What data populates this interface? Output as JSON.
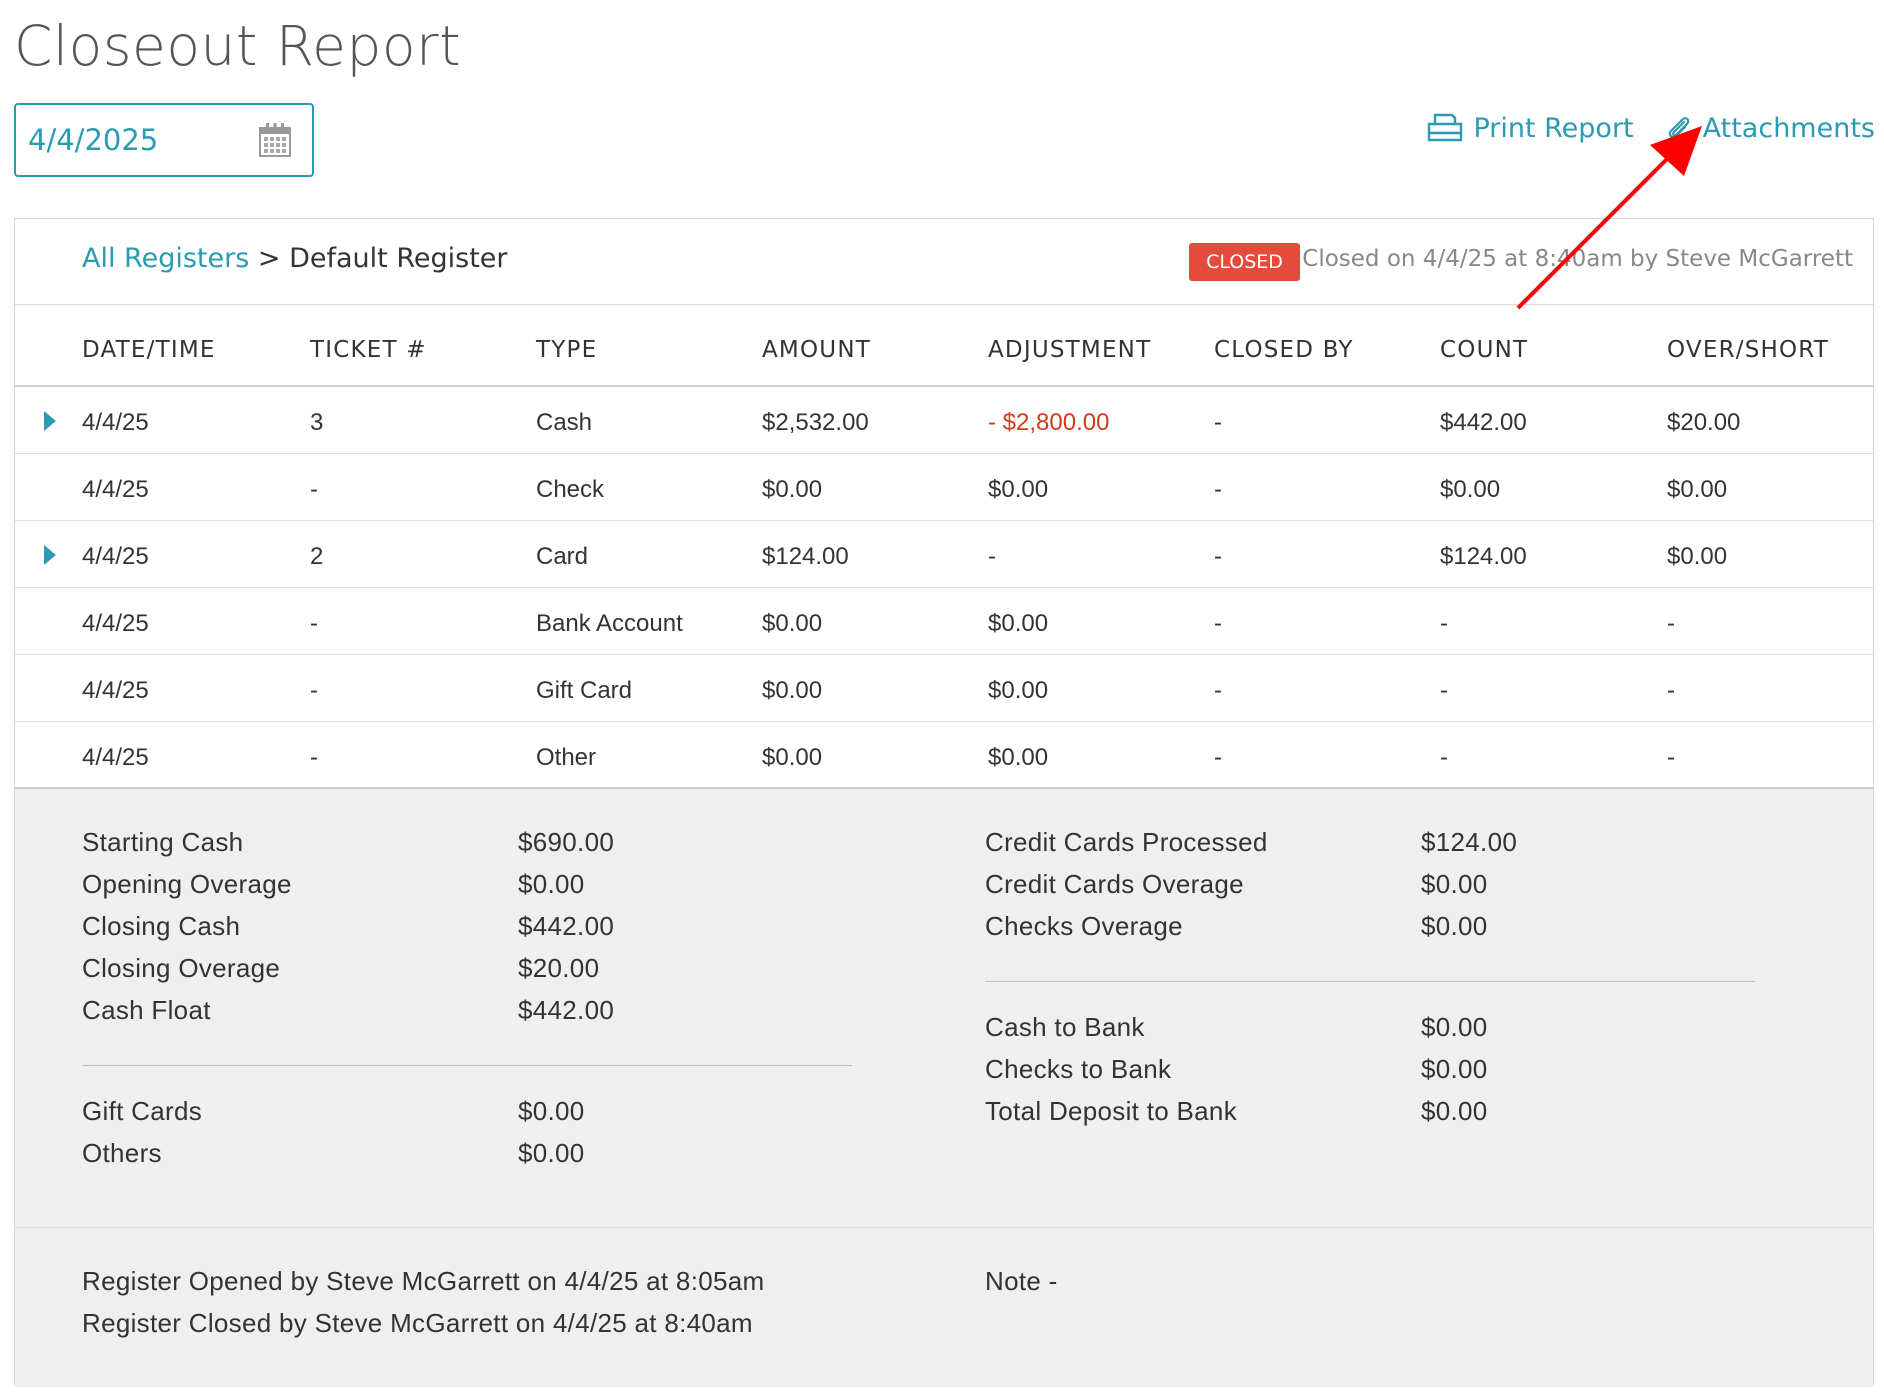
{
  "page": {
    "title": "Closeout Report"
  },
  "date_picker": {
    "value": "4/4/2025"
  },
  "actions": {
    "print_label": "Print Report",
    "attachments_label": "Attachments"
  },
  "register": {
    "breadcrumb_root": "All Registers",
    "separator": ">",
    "current": "Default Register",
    "status_badge": "CLOSED",
    "closed_info": "Closed on 4/4/25 at 8:40am by Steve McGarrett"
  },
  "table": {
    "headers": [
      "DATE/TIME",
      "TICKET #",
      "TYPE",
      "AMOUNT",
      "ADJUSTMENT",
      "CLOSED BY",
      "COUNT",
      "OVER/SHORT"
    ],
    "rows": [
      {
        "expandable": true,
        "cells": [
          "4/4/25",
          "3",
          "Cash",
          "$2,532.00",
          "- $2,800.00",
          "-",
          "$442.00",
          "$20.00"
        ],
        "negative_adjustment": true
      },
      {
        "expandable": false,
        "cells": [
          "4/4/25",
          "-",
          "Check",
          "$0.00",
          "$0.00",
          "-",
          "$0.00",
          "$0.00"
        ],
        "negative_adjustment": false
      },
      {
        "expandable": true,
        "cells": [
          "4/4/25",
          "2",
          "Card",
          "$124.00",
          "-",
          "-",
          "$124.00",
          "$0.00"
        ],
        "negative_adjustment": false
      },
      {
        "expandable": false,
        "cells": [
          "4/4/25",
          "-",
          "Bank Account",
          "$0.00",
          "$0.00",
          "-",
          "-",
          "-"
        ],
        "negative_adjustment": false
      },
      {
        "expandable": false,
        "cells": [
          "4/4/25",
          "-",
          "Gift Card",
          "$0.00",
          "$0.00",
          "-",
          "-",
          "-"
        ],
        "negative_adjustment": false
      },
      {
        "expandable": false,
        "cells": [
          "4/4/25",
          "-",
          "Other",
          "$0.00",
          "$0.00",
          "-",
          "-",
          "-"
        ],
        "negative_adjustment": false
      }
    ]
  },
  "summary": {
    "left_group1": [
      {
        "label": "Starting Cash",
        "value": "$690.00"
      },
      {
        "label": "Opening Overage",
        "value": "$0.00"
      },
      {
        "label": "Closing Cash",
        "value": "$442.00"
      },
      {
        "label": "Closing Overage",
        "value": "$20.00"
      },
      {
        "label": "Cash Float",
        "value": "$442.00"
      }
    ],
    "left_group2": [
      {
        "label": "Gift Cards",
        "value": "$0.00"
      },
      {
        "label": "Others",
        "value": "$0.00"
      }
    ],
    "right_group1": [
      {
        "label": "Credit Cards Processed",
        "value": "$124.00"
      },
      {
        "label": "Credit Cards Overage",
        "value": "$0.00"
      },
      {
        "label": "Checks Overage",
        "value": "$0.00"
      }
    ],
    "right_group2": [
      {
        "label": "Cash to Bank",
        "value": "$0.00"
      },
      {
        "label": "Checks to Bank",
        "value": "$0.00"
      },
      {
        "label": "Total Deposit to Bank",
        "value": "$0.00"
      }
    ]
  },
  "footer": {
    "opened_text": "Register Opened by Steve McGarrett on 4/4/25 at 8:05am",
    "closed_text": "Register Closed by Steve McGarrett on 4/4/25 at 8:40am",
    "note_text": "Note -"
  },
  "colors": {
    "accent": "#2a9bb0",
    "badge": "#e54b3c",
    "negative": "#d23b1a",
    "annotation_arrow": "#ff0000"
  },
  "icons": {
    "calendar": "calendar-icon",
    "print": "printer-icon",
    "attachments": "paperclip-icon",
    "expand": "caret-right-icon"
  }
}
